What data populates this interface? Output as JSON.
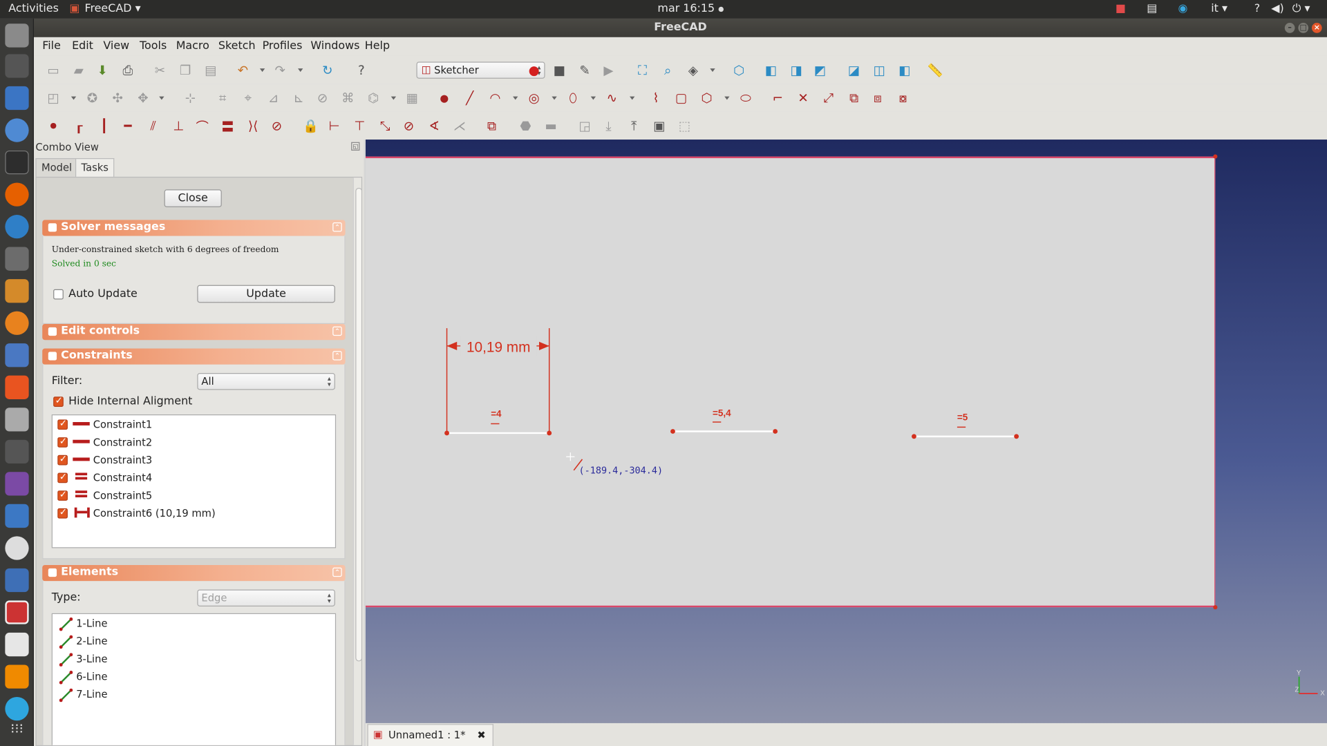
{
  "topbar": {
    "activities": "Activities",
    "app_name": "FreeCAD",
    "clock": "mar 16:15",
    "lang": "it",
    "help": "?"
  },
  "window": {
    "title": "FreeCAD"
  },
  "menu": {
    "items": [
      "File",
      "Edit",
      "View",
      "Tools",
      "Macro",
      "Sketch",
      "Profiles",
      "Windows",
      "Help"
    ]
  },
  "toolbar": {
    "workbench": "Sketcher"
  },
  "combo": {
    "header": "Combo View",
    "tabs": [
      "Model",
      "Tasks"
    ],
    "close_button": "Close",
    "solver": {
      "title": "Solver messages",
      "message": "Under-constrained sketch with 6 degrees of freedom",
      "solved": "Solved in 0 sec",
      "auto_update": "Auto Update",
      "update_button": "Update"
    },
    "edit_controls": {
      "title": "Edit controls"
    },
    "constraints": {
      "title": "Constraints",
      "filter_label": "Filter:",
      "filter_value": "All",
      "hide_internal": "Hide Internal Aligment",
      "items": [
        {
          "label": "Constraint1",
          "kind": "horizontal"
        },
        {
          "label": "Constraint2",
          "kind": "horizontal"
        },
        {
          "label": "Constraint3",
          "kind": "horizontal"
        },
        {
          "label": "Constraint4",
          "kind": "equal"
        },
        {
          "label": "Constraint5",
          "kind": "equal"
        },
        {
          "label": "Constraint6 (10,19 mm)",
          "kind": "distance"
        }
      ]
    },
    "elements": {
      "title": "Elements",
      "type_label": "Type:",
      "type_value": "Edge",
      "items": [
        "1-Line",
        "2-Line",
        "3-Line",
        "6-Line",
        "7-Line"
      ]
    }
  },
  "view": {
    "dimension": "10,19 mm",
    "label_a": "=4",
    "label_b": "=5,4",
    "label_c": "=5",
    "cursor_coords": "(-189.4,-304.4)"
  },
  "doc_tab": {
    "label": "Unnamed1 : 1*"
  },
  "colors": {
    "accent": "#e98659",
    "constraint_red": "#b71c1c",
    "sketch_red": "#d3311f"
  }
}
